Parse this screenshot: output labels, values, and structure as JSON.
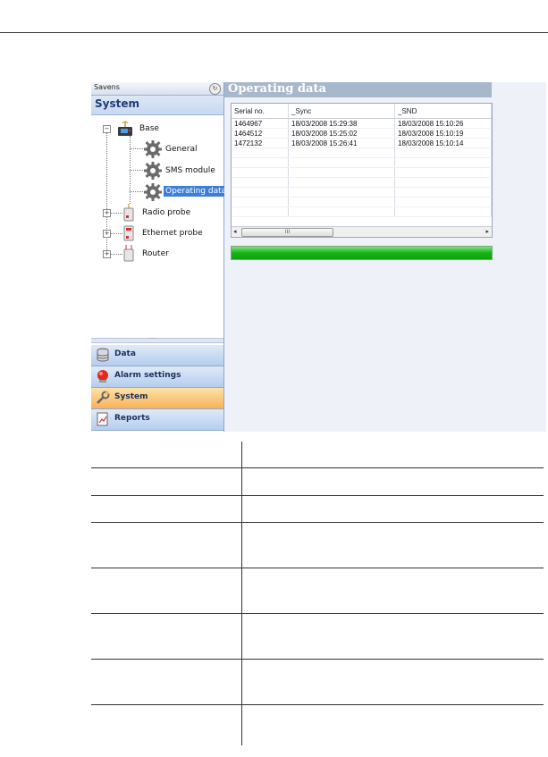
{
  "app": {
    "navigator_title": "Savens",
    "section_title": "System",
    "tree": {
      "root": "Base",
      "children": [
        "General",
        "SMS module",
        "Operating data"
      ],
      "siblings": [
        "Radio probe",
        "Ethernet probe",
        "Router"
      ],
      "selected": "Operating data"
    },
    "nav_buttons": [
      {
        "label": "Data",
        "icon": "database-icon"
      },
      {
        "label": "Alarm settings",
        "icon": "alarm-icon"
      },
      {
        "label": "System",
        "icon": "wrench-icon",
        "active": true
      },
      {
        "label": "Reports",
        "icon": "report-icon"
      }
    ],
    "content_title": "Operating data",
    "grid": {
      "columns": [
        "Serial no.",
        "_Sync",
        "_SND"
      ],
      "rows": [
        [
          "1464967",
          "18/03/2008 15:29:38",
          "18/03/2008 15:10:26"
        ],
        [
          "1464512",
          "18/03/2008 15:25:02",
          "18/03/2008 15:10:19"
        ],
        [
          "1472132",
          "18/03/2008 15:26:41",
          "18/03/2008 15:10:14"
        ]
      ],
      "scroll_thumb_glyph": "III"
    },
    "progress_percent": 100,
    "colors": {
      "accent": "#3c7fd9",
      "active_nav": "#f8b257",
      "progress": "#16b316",
      "header_band": "#a8b8cc"
    }
  }
}
